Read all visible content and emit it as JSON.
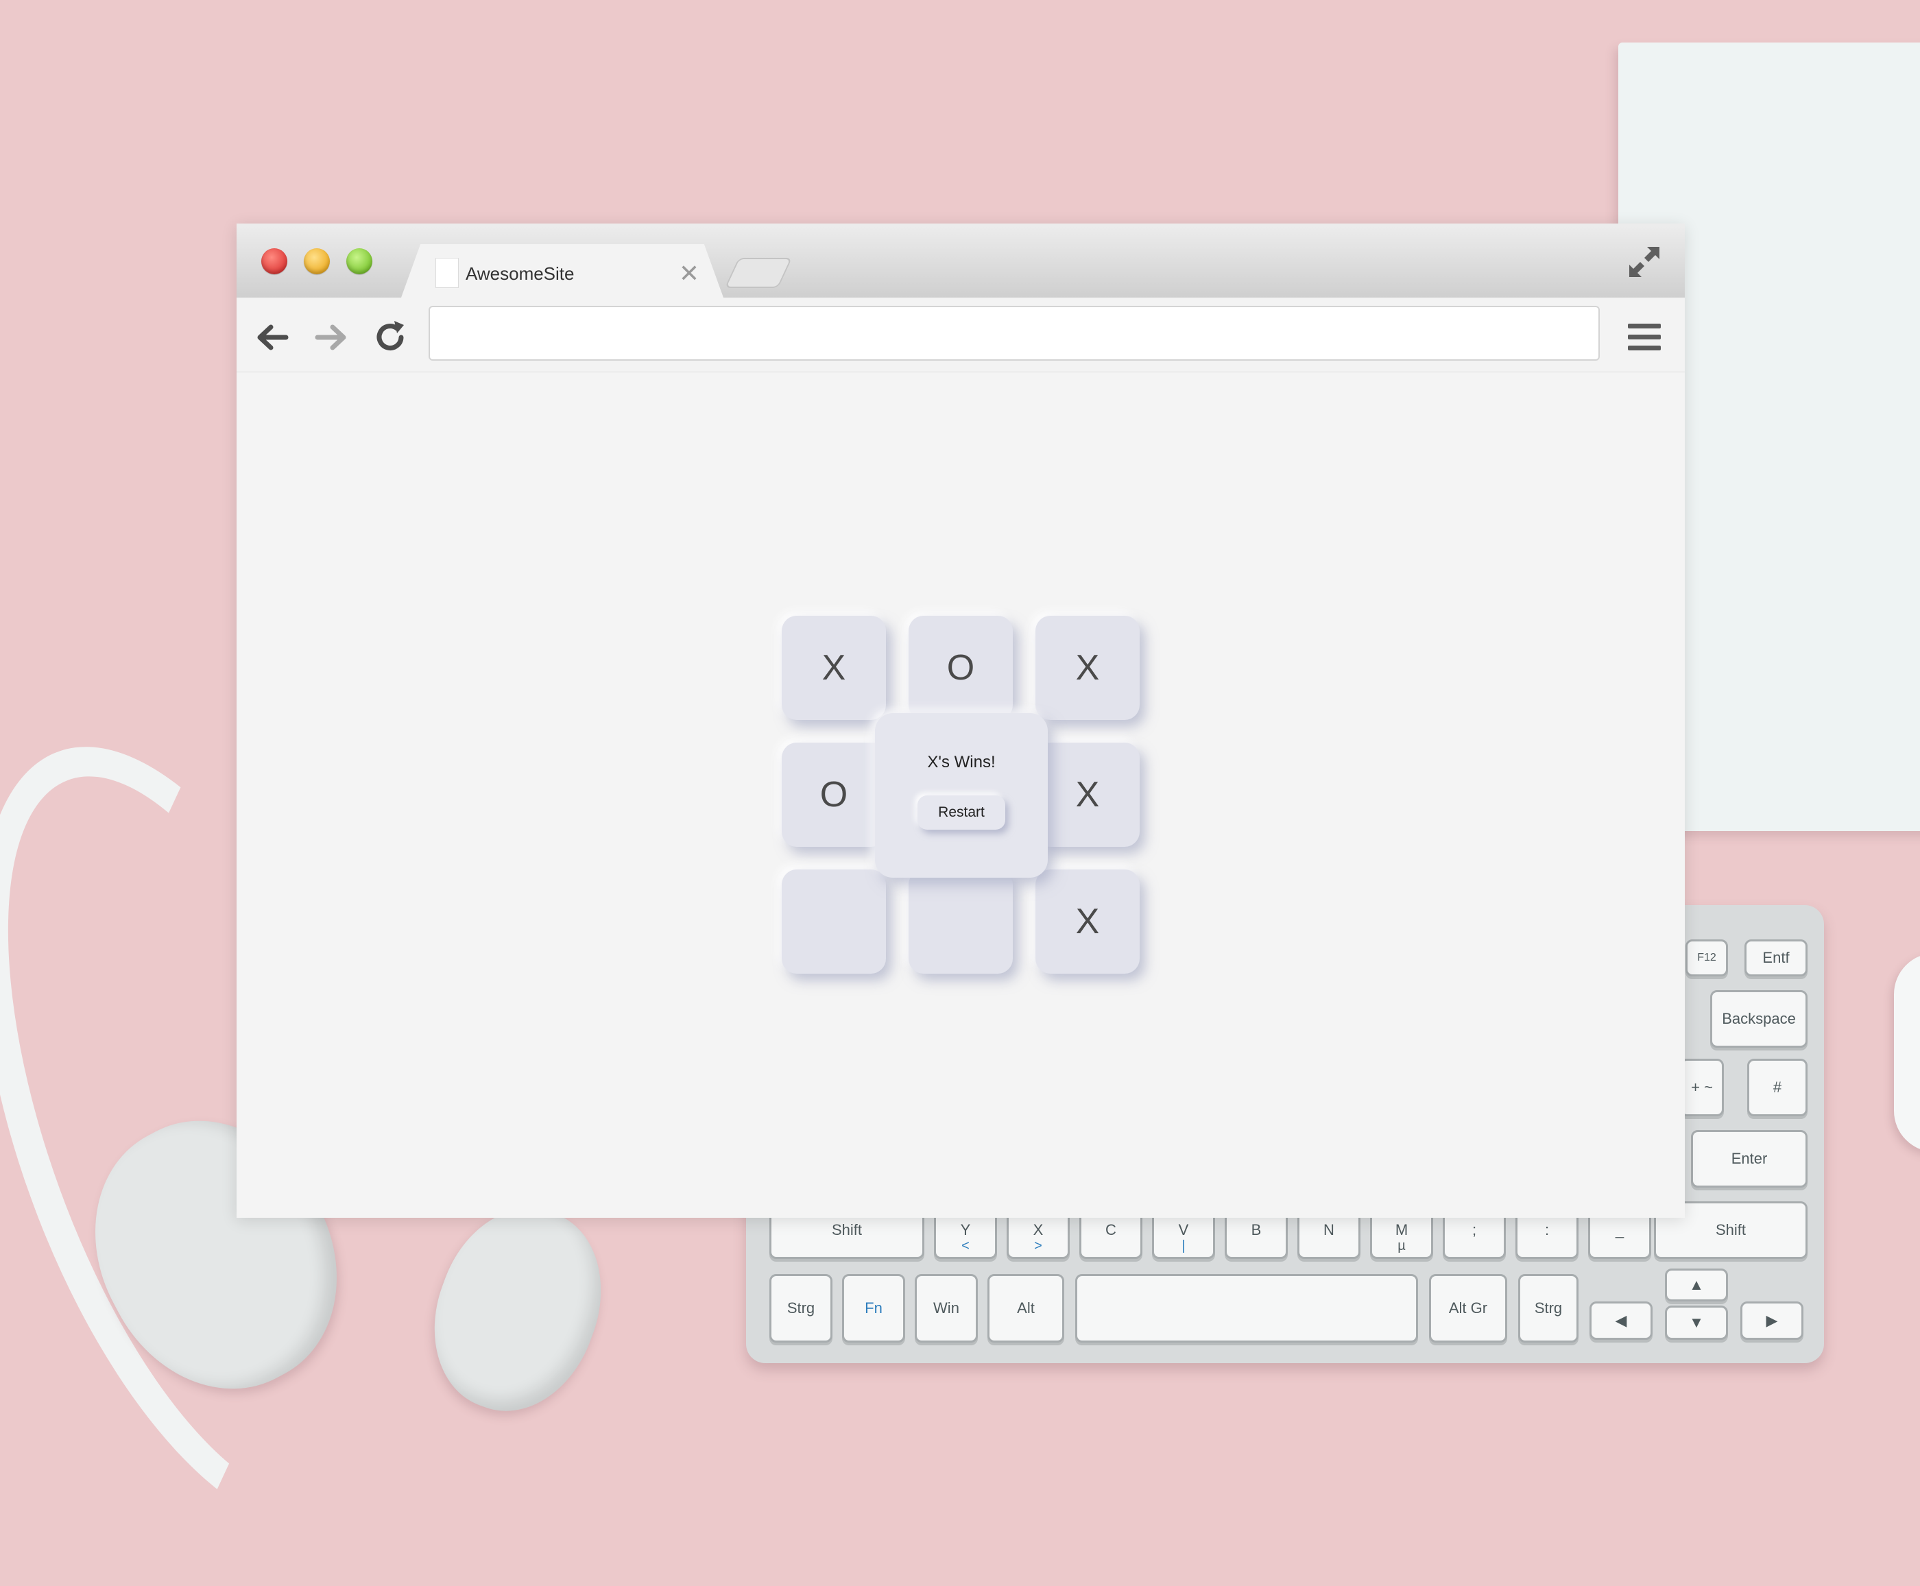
{
  "browser": {
    "tab_title": "AwesomeSite",
    "tab_close": "✕",
    "address_value": ""
  },
  "game": {
    "board": [
      [
        "X",
        "O",
        "X"
      ],
      [
        "O",
        "",
        "X"
      ],
      [
        "",
        "",
        "X"
      ]
    ],
    "message": "X's Wins!",
    "restart_label": "Restart"
  },
  "keyboard": {
    "keys": [
      "Entf",
      "F12",
      "Backspace",
      "+",
      "~",
      "*",
      "#",
      "'",
      "Enter",
      "Shift",
      "Y",
      "<",
      "X",
      ">",
      "C",
      "V",
      "|",
      "B",
      "N",
      "M",
      "µ",
      ";",
      ",",
      ":",
      ".",
      "_",
      "-",
      "Shift",
      "Strg",
      "Fn",
      "Win",
      "Alt",
      "Alt Gr",
      "Strg",
      "▲",
      "◀",
      "▼",
      "▶"
    ]
  }
}
